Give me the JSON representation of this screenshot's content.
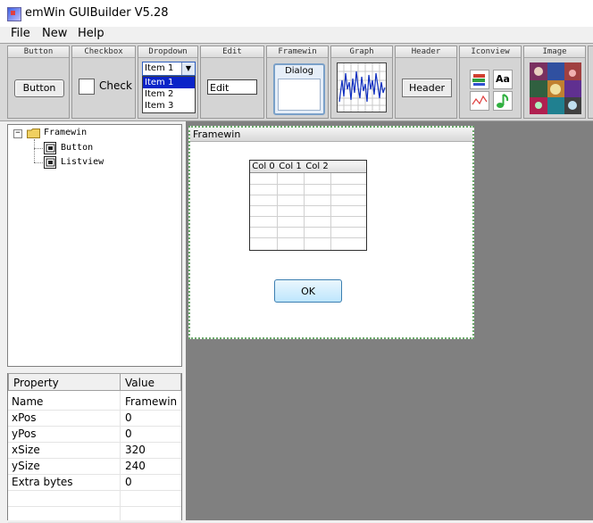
{
  "window": {
    "title": "emWin GUIBuilder V5.28"
  },
  "menu": {
    "items": [
      "File",
      "New",
      "Help"
    ]
  },
  "palette": {
    "button": {
      "header": "Button",
      "label": "Button"
    },
    "checkbox": {
      "header": "Checkbox",
      "label": "Check"
    },
    "dropdown": {
      "header": "Dropdown",
      "selected": "Item 1",
      "items": [
        "Item 1",
        "Item 2",
        "Item 3"
      ]
    },
    "edit": {
      "header": "Edit",
      "value": "Edit"
    },
    "framewin": {
      "header": "Framewin",
      "label": "Dialog"
    },
    "graph": {
      "header": "Graph"
    },
    "header": {
      "header": "Header",
      "label": "Header"
    },
    "iconview": {
      "header": "Iconview",
      "font_label": "Aa"
    },
    "image": {
      "header": "Image"
    }
  },
  "tree": {
    "root": "Framewin",
    "children": [
      "Button",
      "Listview"
    ]
  },
  "properties": {
    "col_property": "Property",
    "col_value": "Value",
    "rows": [
      {
        "name": "Name",
        "value": "Framewin"
      },
      {
        "name": "xPos",
        "value": "0"
      },
      {
        "name": "yPos",
        "value": "0"
      },
      {
        "name": "xSize",
        "value": "320"
      },
      {
        "name": "ySize",
        "value": "240"
      },
      {
        "name": "Extra bytes",
        "value": "0"
      }
    ]
  },
  "canvas": {
    "frame_title": "Framewin",
    "listview_columns": [
      "Col 0",
      "Col 1",
      "Col 2"
    ],
    "ok_label": "OK"
  },
  "colors": {
    "canvas_bg": "#808080",
    "selection_blue": "#0a24c8",
    "frame_border": "#6aa86a"
  }
}
